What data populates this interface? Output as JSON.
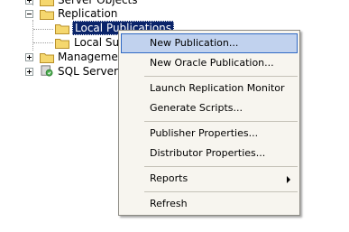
{
  "tree": {
    "items": [
      {
        "label": "Server Objects",
        "expander": "plus"
      },
      {
        "label": "Replication",
        "expander": "minus"
      },
      {
        "label": "Local Publications",
        "selected": true
      },
      {
        "label": "Local Subscriptions"
      },
      {
        "label": "Management",
        "expander": "plus"
      },
      {
        "label": "SQL Server Agent",
        "expander": "plus"
      }
    ]
  },
  "context_menu": {
    "items": [
      {
        "label": "New Publication...",
        "hover": true
      },
      {
        "label": "New Oracle Publication..."
      },
      {
        "label": "Launch Replication Monitor"
      },
      {
        "label": "Generate Scripts..."
      },
      {
        "label": "Publisher Properties..."
      },
      {
        "label": "Distributor Properties..."
      },
      {
        "label": "Reports",
        "submenu": true
      },
      {
        "label": "Refresh"
      }
    ]
  },
  "colors": {
    "selection": "#0a246a",
    "menu_background": "#f7f5ef",
    "menu_hover": "#c1d2ee",
    "menu_hover_border": "#316ac5",
    "folder": "#f5d76e"
  }
}
